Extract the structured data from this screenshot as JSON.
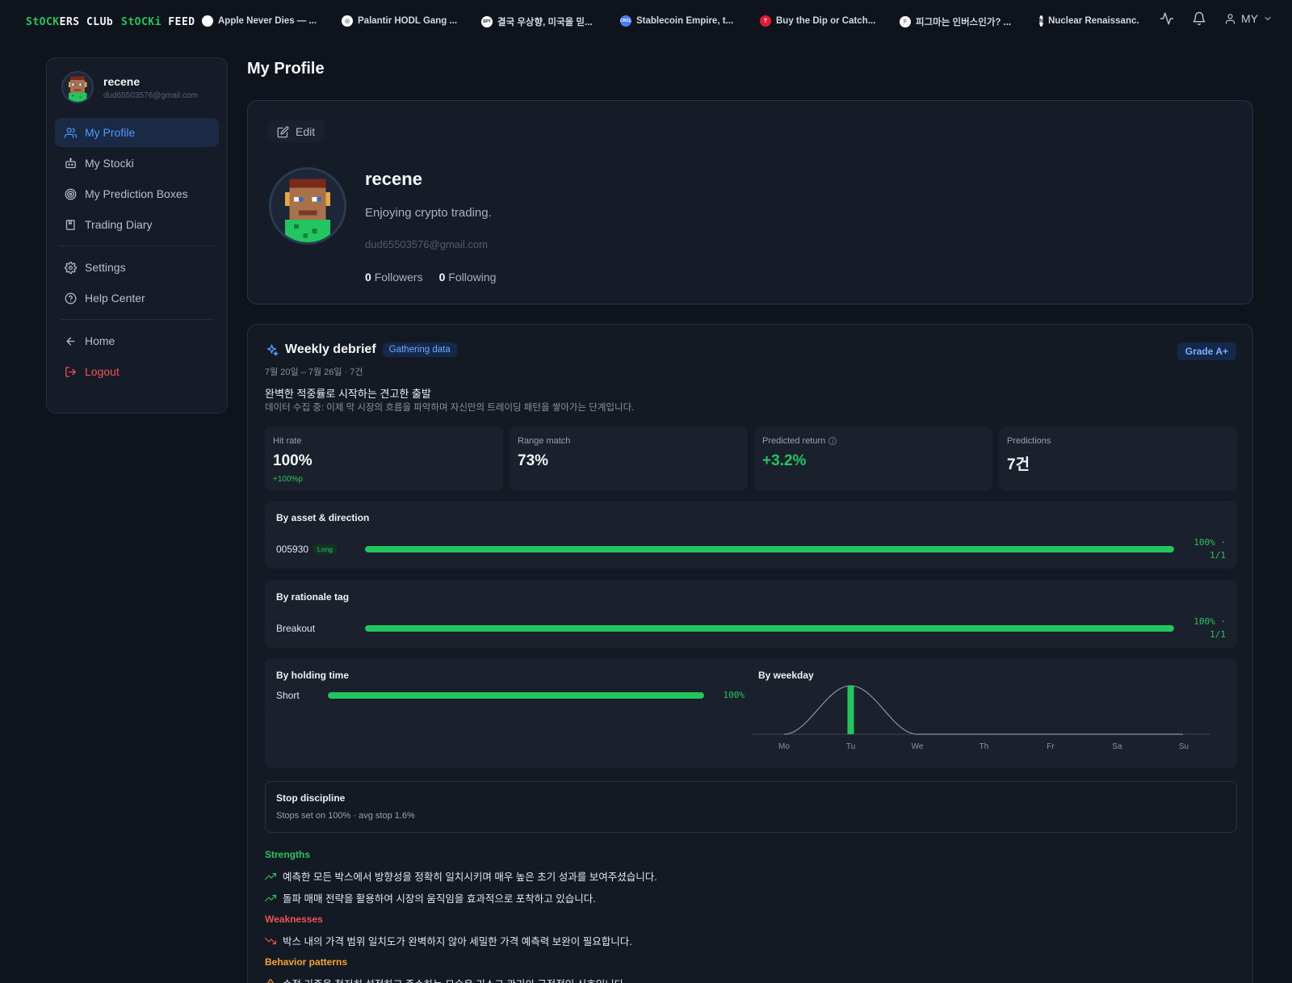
{
  "topbar": {
    "logo_main_a": "StOCK",
    "logo_main_b": "ERS CLUb",
    "logo_feed_a": "StOCKi",
    "logo_feed_b": " FEED",
    "tickers": [
      {
        "label": "Apple Never Dies — ...",
        "icon_color": "#ffffff",
        "icon_char": ""
      },
      {
        "label": "Palantir HODL Gang ...",
        "icon_color": "#ffffff",
        "icon_char": "◎"
      },
      {
        "label": "결국 우상향, 미국을 믿...",
        "icon_color": "#ffffff",
        "icon_char": "SPY"
      },
      {
        "label": "Stablecoin Empire, t...",
        "icon_color": "#4b7bff",
        "icon_char": "CRCL"
      },
      {
        "label": "Buy the Dip or Catch...",
        "icon_color": "#e31937",
        "icon_char": "T"
      },
      {
        "label": "피그마는 인버스인가? ...",
        "icon_color": "#ffffff",
        "icon_char": "F"
      },
      {
        "label": "Nuclear Renaissanc...",
        "icon_color": "#ffffff",
        "icon_char": "N"
      }
    ],
    "my_label": "MY"
  },
  "sidebar": {
    "user_name": "recene",
    "user_email": "dud65503576@gmail.com",
    "items": [
      {
        "label": "My Profile"
      },
      {
        "label": "My Stocki"
      },
      {
        "label": "My Prediction Boxes"
      },
      {
        "label": "Trading Diary"
      },
      {
        "label": "Settings"
      },
      {
        "label": "Help Center"
      },
      {
        "label": "Home"
      },
      {
        "label": "Logout"
      }
    ]
  },
  "page": {
    "title": "My Profile"
  },
  "profile": {
    "edit_label": "Edit",
    "name": "recene",
    "bio": "Enjoying crypto trading.",
    "email": "dud65503576@gmail.com",
    "followers_count": "0",
    "followers_label": "Followers",
    "following_count": "0",
    "following_label": "Following"
  },
  "debrief": {
    "title": "Weekly debrief",
    "status_pill": "Gathering data",
    "grade": "Grade A+",
    "range": "7월 20일 – 7월 26일 · 7건",
    "headline": "완벽한 적중률로 시작하는 견고한 출발",
    "subline": "데이터 수집 중: 이제 막 시장의 흐름을 파악하며 자신만의 트레이딩 패턴을 쌓아가는 단계입니다.",
    "stats": [
      {
        "label": "Hit rate",
        "value": "100%",
        "delta": "+100%p"
      },
      {
        "label": "Range match",
        "value": "73%",
        "delta": ""
      },
      {
        "label": "Predicted return",
        "value": "+3.2%",
        "delta": ""
      },
      {
        "label": "Predictions",
        "value": "7건",
        "delta": ""
      }
    ],
    "by_asset": {
      "title": "By asset & direction",
      "rows": [
        {
          "label": "005930",
          "tag": "Long",
          "fraction": 1.0,
          "value_line1": "100% ·",
          "value_line2": "1/1"
        }
      ]
    },
    "by_tag": {
      "title": "By rationale tag",
      "rows": [
        {
          "label": "Breakout",
          "fraction": 1.0,
          "value_line1": "100% ·",
          "value_line2": "1/1"
        }
      ]
    },
    "by_holding": {
      "title": "By holding time",
      "rows": [
        {
          "label": "Short",
          "fraction": 1.0,
          "value": "100%"
        }
      ]
    },
    "by_weekday": {
      "title": "By weekday",
      "days": [
        "Mo",
        "Tu",
        "We",
        "Th",
        "Fr",
        "Sa",
        "Su"
      ],
      "values": [
        0,
        1,
        0,
        0,
        0,
        0,
        0
      ]
    },
    "stops": {
      "title": "Stop discipline",
      "detail": "Stops set on 100% · avg stop 1.6%"
    },
    "strengths_label": "Strengths",
    "strengths": [
      "예측한 모든 박스에서 방향성을 정확히 일치시키며 매우 높은 초기 성과를 보여주셨습니다.",
      "돌파 매매 전략을 활용하여 시장의 움직임을 효과적으로 포착하고 있습니다."
    ],
    "weaknesses_label": "Weaknesses",
    "weaknesses": [
      "박스 내의 가격 범위 일치도가 완벽하지 않아 세밀한 가격 예측력 보완이 필요합니다."
    ],
    "behavior_label": "Behavior patterns",
    "behavior": [
      "손절 기준을 철저히 설정하고 준수하는 모습은 리스크 관리의 긍정적인 신호입니다."
    ]
  },
  "colors": {
    "accent_green": "#22c55e",
    "accent_blue": "#4d9bff",
    "danger": "#f05252",
    "warning": "#f5a524"
  }
}
